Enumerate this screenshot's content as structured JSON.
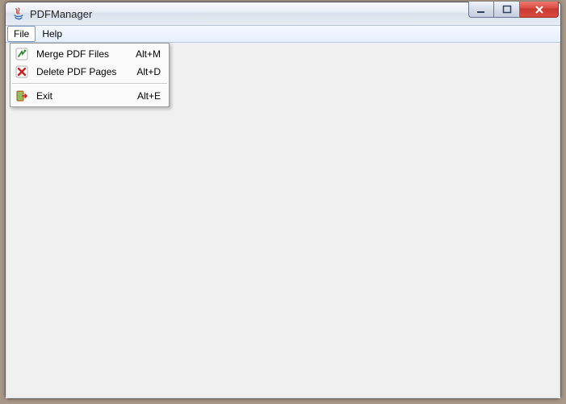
{
  "window": {
    "title": "PDFManager"
  },
  "menubar": {
    "items": [
      {
        "label": "File"
      },
      {
        "label": "Help"
      }
    ]
  },
  "file_menu": {
    "items": [
      {
        "icon": "merge-icon",
        "label": "Merge PDF Files",
        "accel": "Alt+M"
      },
      {
        "icon": "delete-icon",
        "label": "Delete PDF Pages",
        "accel": "Alt+D"
      },
      {
        "icon": "exit-icon",
        "label": "Exit",
        "accel": "Alt+E"
      }
    ]
  }
}
